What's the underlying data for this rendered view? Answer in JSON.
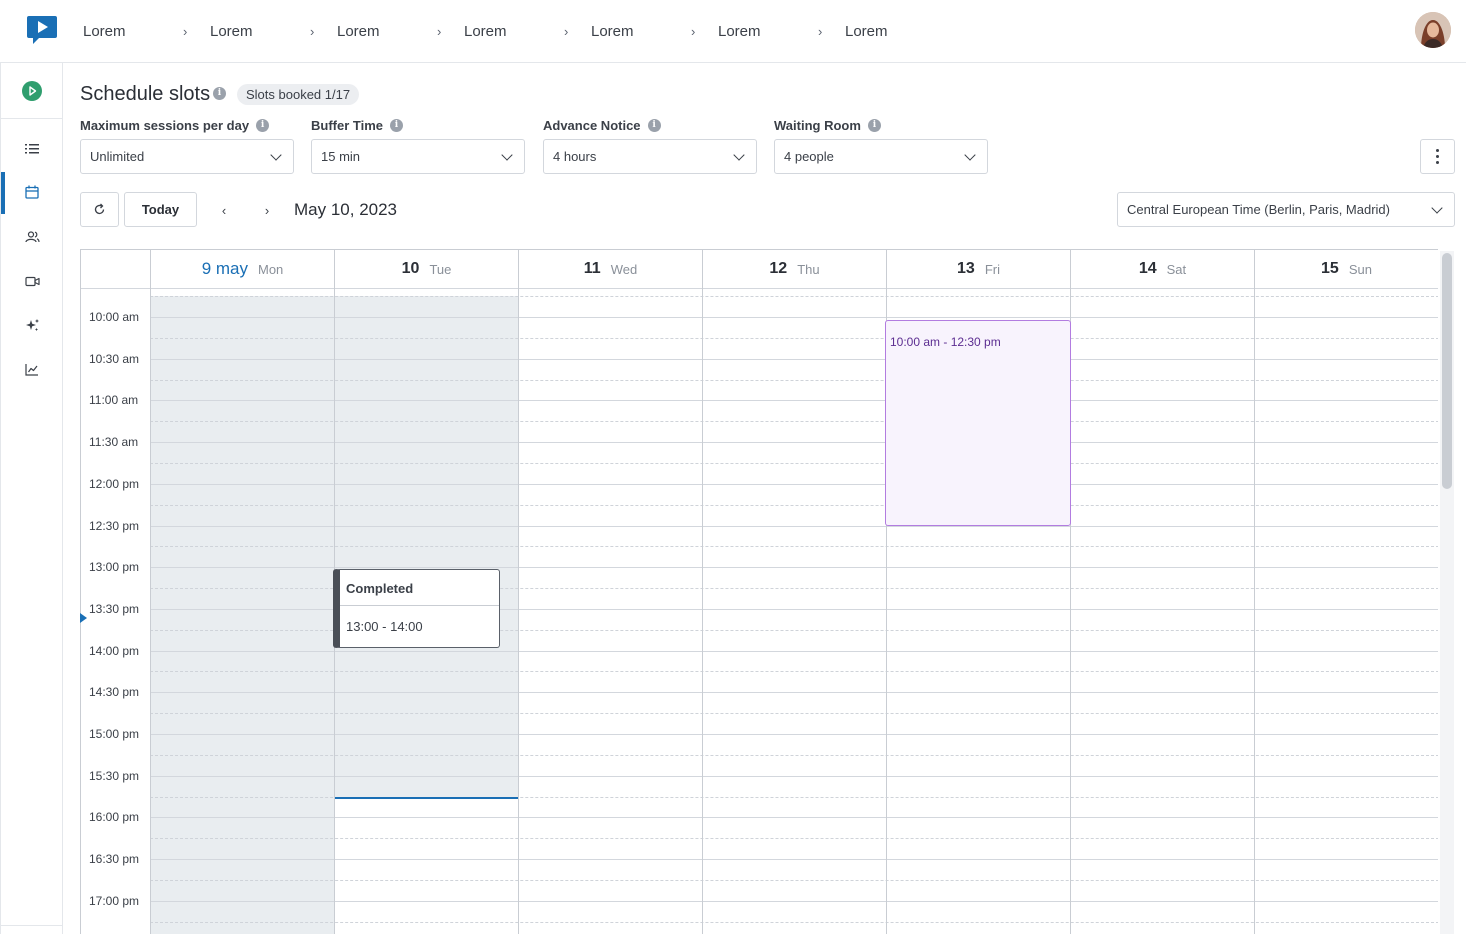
{
  "breadcrumbs": [
    "Lorem",
    "Lorem",
    "Lorem",
    "Lorem",
    "Lorem",
    "Lorem",
    "Lorem"
  ],
  "breadcrumb_separator": "›",
  "icons": {
    "logo": "video-play-logo-icon",
    "sidebar": [
      "play-circle-icon",
      "list-icon",
      "calendar-icon",
      "users-icon",
      "video-camera-icon",
      "sparkles-icon",
      "line-chart-icon"
    ]
  },
  "colors": {
    "accent": "#1a6fb5",
    "slot_border": "#b27ce0",
    "slot_text": "#5c2d91",
    "shade": "#e9edf0"
  },
  "header": {
    "title": "Schedule slots",
    "badge": "Slots booked 1/17"
  },
  "fields": [
    {
      "label": "Maximum sessions per day",
      "value": "Unlimited"
    },
    {
      "label": "Buffer Time",
      "value": "15 min"
    },
    {
      "label": "Advance Notice",
      "value": "4 hours"
    },
    {
      "label": "Waiting Room",
      "value": "4 people"
    }
  ],
  "toolbar": {
    "today_label": "Today",
    "prev_label": "‹",
    "next_label": "›",
    "current_date": "May 10, 2023",
    "timezone": "Central European Time (Berlin, Paris, Madrid)"
  },
  "days": [
    {
      "num": "9 may",
      "name": "Mon",
      "today": true
    },
    {
      "num": "10",
      "name": "Tue",
      "today": false
    },
    {
      "num": "11",
      "name": "Wed",
      "today": false
    },
    {
      "num": "12",
      "name": "Thu",
      "today": false
    },
    {
      "num": "13",
      "name": "Fri",
      "today": false
    },
    {
      "num": "14",
      "name": "Sat",
      "today": false
    },
    {
      "num": "15",
      "name": "Sun",
      "today": false
    }
  ],
  "times": [
    "10:00 am",
    "10:30 am",
    "11:00 am",
    "11:30 am",
    "12:00 pm",
    "12:30 pm",
    "13:00 pm",
    "13:30 pm",
    "14:00 pm",
    "14:30 pm",
    "15:00 pm",
    "15:30 pm",
    "16:00 pm",
    "16:30 pm",
    "17:00 pm"
  ],
  "events": {
    "completed": {
      "title": "Completed",
      "time": "13:00 - 14:00"
    },
    "slot": {
      "time": "10:00 am - 12:30 pm"
    }
  }
}
